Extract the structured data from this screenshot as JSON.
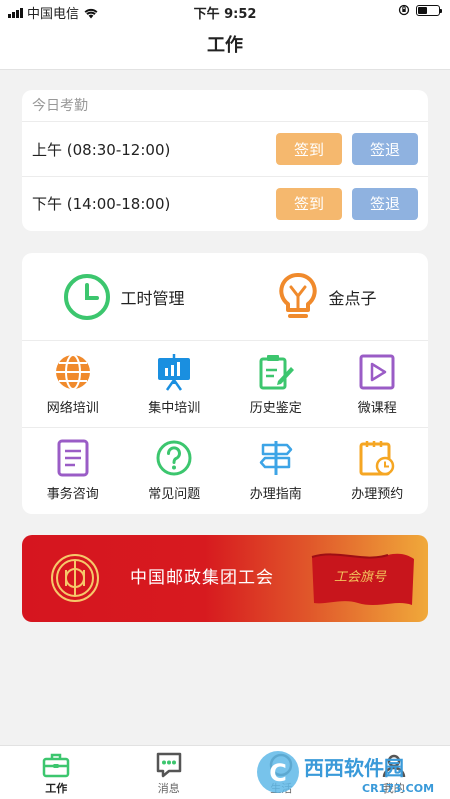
{
  "status_bar": {
    "carrier": "中国电信",
    "time": "下午 9:52"
  },
  "navbar": {
    "title": "工作"
  },
  "attendance": {
    "header": "今日考勤",
    "rows": [
      {
        "period": "上午 (08:30-12:00)",
        "signin_label": "签到",
        "signout_label": "签退"
      },
      {
        "period": "下午 (14:00-18:00)",
        "signin_label": "签到",
        "signout_label": "签退"
      }
    ]
  },
  "services": {
    "top": [
      {
        "label": "工时管理",
        "icon": "clock-icon"
      },
      {
        "label": "金点子",
        "icon": "lightbulb-icon"
      }
    ],
    "grid": [
      {
        "label": "网络培训",
        "icon": "globe-icon"
      },
      {
        "label": "集中培训",
        "icon": "presentation-board-icon"
      },
      {
        "label": "历史鉴定",
        "icon": "clipboard-pen-icon"
      },
      {
        "label": "微课程",
        "icon": "play-icon"
      },
      {
        "label": "事务咨询",
        "icon": "document-icon"
      },
      {
        "label": "常见问题",
        "icon": "question-icon"
      },
      {
        "label": "办理指南",
        "icon": "signpost-icon"
      },
      {
        "label": "办理预约",
        "icon": "calendar-clock-icon"
      }
    ]
  },
  "banner": {
    "title": "中国邮政集团工会",
    "flag_text": "工会旗号"
  },
  "tabbar": {
    "tabs": [
      {
        "label": "工作",
        "icon": "briefcase-icon",
        "active": true
      },
      {
        "label": "消息",
        "icon": "chat-bubble-icon",
        "active": false
      },
      {
        "label": "生活",
        "icon": "life-icon",
        "active": false
      },
      {
        "label": "我的",
        "icon": "profile-icon",
        "active": false
      }
    ]
  },
  "watermark": {
    "brand": "西西软件园",
    "url": "CR173.COM"
  },
  "colors": {
    "signin": "#f5b86e",
    "signout": "#8fb2e0",
    "green": "#3cc66e",
    "orange": "#f08a2c",
    "blue": "#1a8fe0",
    "purple": "#9a5cc6",
    "banner_red": "#d6151f"
  }
}
